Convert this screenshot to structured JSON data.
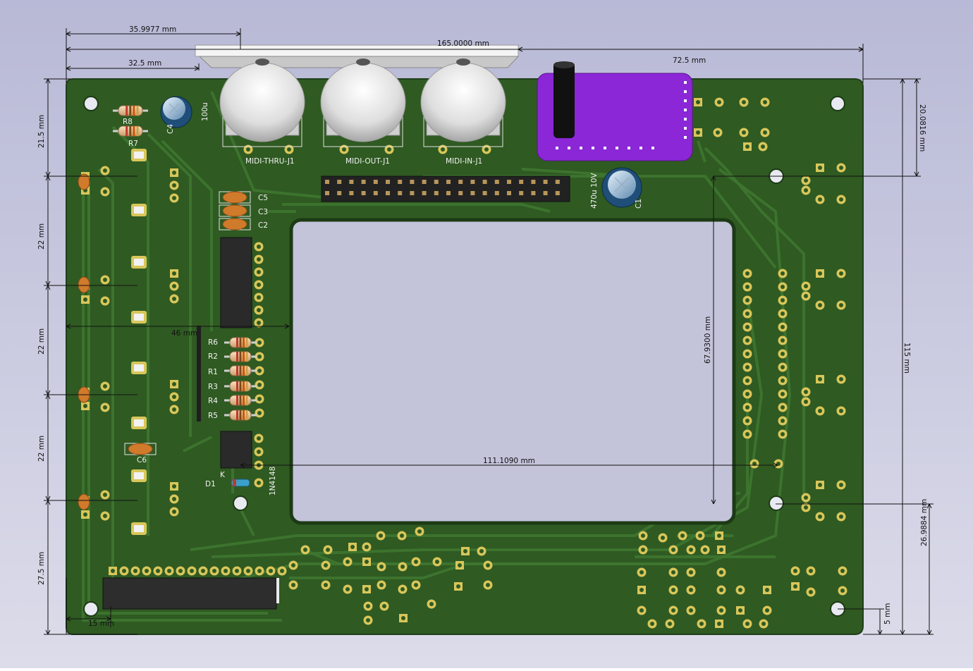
{
  "colors": {
    "background_top": "#b9bad6",
    "background_bottom": "#d9dae9",
    "board": "#2f5a22",
    "trace": "#3c6f2b",
    "pad": "#d8c65a",
    "silk": "#f2f2f2",
    "dimension": "#111111",
    "module": "#8b27d6"
  },
  "dimensions": {
    "width_36": "35.9977 mm",
    "width_165": "165.0000 mm",
    "width_32_5": "32.5 mm",
    "width_72_5": "72.5 mm",
    "width_46": "46 mm",
    "width_111": "111.1090 mm",
    "width_15": "15 mm",
    "height_21_5": "21.5 mm",
    "height_22_a": "22 mm",
    "height_22_b": "22 mm",
    "height_22_c": "22 mm",
    "height_27_5": "27.5 mm",
    "height_20": "20.0816 mm",
    "height_115": "115 mm",
    "height_67": "67.9300 mm",
    "height_26": "26.9884 mm",
    "height_5": "5 mm"
  },
  "labels": {
    "midi_thru": "MIDI-THRU-J1",
    "midi_out": "MIDI-OUT-J1",
    "midi_in": "MIDI-IN-J1",
    "c1": "C1",
    "c1_value": "470u 10V",
    "c2": "C2",
    "c3": "C3",
    "c4": "C4",
    "c4_value": "100u",
    "c5": "C5",
    "c6": "C6",
    "r1": "R1",
    "r2": "R2",
    "r3": "R3",
    "r4": "R4",
    "r5": "R5",
    "r6": "R6",
    "r7": "R7",
    "r8": "R8",
    "d1": "D1",
    "d1_value": "1N4148",
    "k": "K"
  }
}
